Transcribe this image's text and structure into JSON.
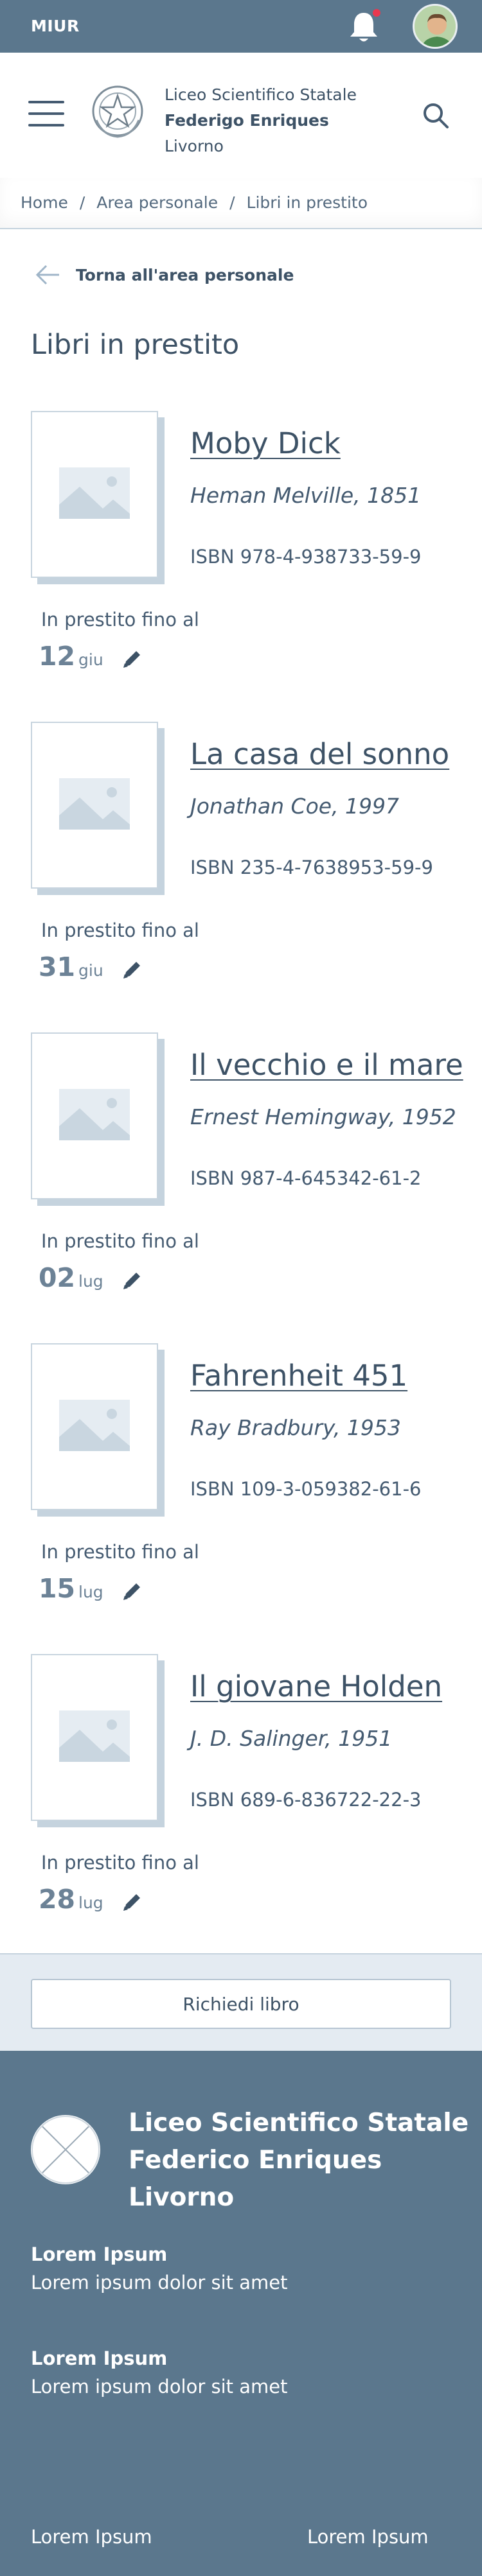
{
  "topbar": {
    "brand": "MIUR",
    "notification_badge_color": "#e8384f"
  },
  "header": {
    "school_line1": "Liceo Scientifico Statale",
    "school_line2": "Federigo Enriques",
    "school_line3": "Livorno"
  },
  "breadcrumb": {
    "items": [
      "Home",
      "Area personale",
      "Libri in prestito"
    ]
  },
  "back_link": "Torna all'area personale",
  "page_title": "Libri in prestito",
  "books": [
    {
      "title": "Moby Dick",
      "author": "Heman Melville, 1851",
      "isbn": "ISBN 978-4-938733-59-9",
      "loan_label": "In prestito fino al",
      "day": "12",
      "month": "giu"
    },
    {
      "title": "La casa del sonno",
      "author": "Jonathan Coe,  1997",
      "isbn": "ISBN 235-4-7638953-59-9",
      "loan_label": "In prestito fino al",
      "day": "31",
      "month": "giu"
    },
    {
      "title": "Il vecchio e il mare",
      "author": "Ernest Hemingway,  1952",
      "isbn": "ISBN 987-4-645342-61-2",
      "loan_label": "In prestito fino al",
      "day": "02",
      "month": "lug"
    },
    {
      "title": "Fahrenheit 451",
      "author": "Ray Bradbury,  1953",
      "isbn": "ISBN 109-3-059382-61-6",
      "loan_label": "In prestito fino al",
      "day": "15",
      "month": "lug"
    },
    {
      "title": "Il giovane Holden",
      "author": "J. D. Salinger, 1951",
      "isbn": "ISBN 689-6-836722-22-3",
      "loan_label": "In prestito fino al",
      "day": "28",
      "month": "lug"
    }
  ],
  "request_button": "Richiedi libro",
  "footer": {
    "name_line1": "Liceo Scientifico Statale",
    "name_line2": "Federico Enriques",
    "name_line3": "Livorno",
    "block1_title": "Lorem Ipsum",
    "block1_text": "Lorem ipsum dolor sit amet",
    "block2_title": "Lorem Ipsum",
    "block2_text": "Lorem ipsum dolor sit amet",
    "link_left": "Lorem Ipsum",
    "link_right": "Lorem Ipsum"
  },
  "colors": {
    "primary": "#5b778d",
    "text": "#455b71",
    "light_band": "#e4ebf2"
  }
}
